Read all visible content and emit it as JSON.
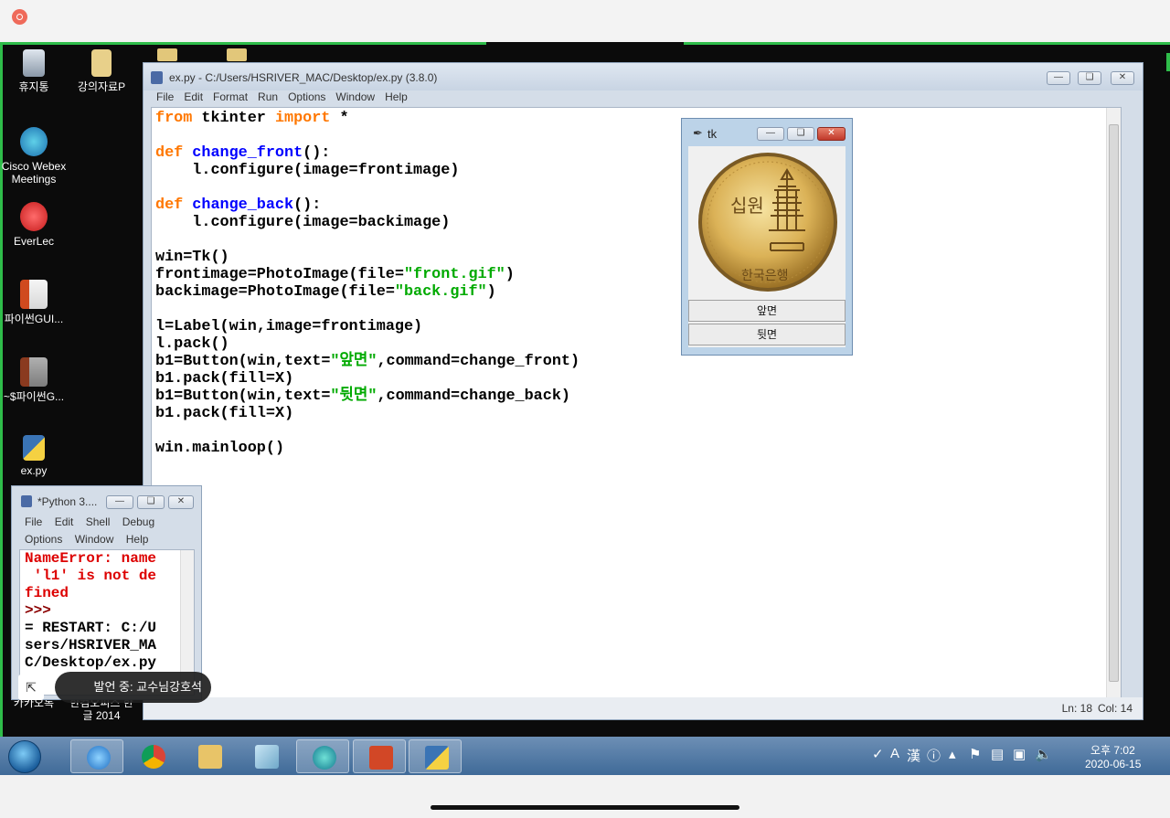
{
  "desktop": {
    "icons": [
      {
        "label": "휴지통",
        "icon": "recycle-bin-icon"
      },
      {
        "label": "강의자료P",
        "icon": "folder-icon"
      },
      {
        "label": "Cisco Webex Meetings",
        "icon": "webex-icon"
      },
      {
        "label": "EverLec",
        "icon": "everlec-icon"
      },
      {
        "label": "파이썬GUI...",
        "icon": "powerpoint-file-icon"
      },
      {
        "label": "~$파이썬G...",
        "icon": "powerpoint-file-icon"
      },
      {
        "label": "ex.py",
        "icon": "python-file-icon"
      },
      {
        "label": "카카오톡",
        "icon": "kakaotalk-icon"
      },
      {
        "label": "한컴오피스 한글 2014",
        "icon": "hancom-icon"
      }
    ]
  },
  "editor": {
    "title": "ex.py - C:/Users/HSRIVER_MAC/Desktop/ex.py (3.8.0)",
    "menu": [
      "File",
      "Edit",
      "Format",
      "Run",
      "Options",
      "Window",
      "Help"
    ],
    "code_lines": [
      "from tkinter import *",
      "",
      "def change_front():",
      "    l.configure(image=frontimage)",
      "",
      "def change_back():",
      "    l.configure(image=backimage)",
      "",
      "win=Tk()",
      "frontimage=PhotoImage(file=\"front.gif\")",
      "backimage=PhotoImage(file=\"back.gif\")",
      "",
      "l=Label(win,image=frontimage)",
      "l.pack()",
      "b1=Button(win,text=\"앞면\",command=change_front)",
      "b1.pack(fill=X)",
      "b1=Button(win,text=\"뒷면\",command=change_back)",
      "b1.pack(fill=X)",
      "",
      "win.mainloop()"
    ],
    "status": {
      "line": "Ln: 18",
      "col": "Col: 14"
    }
  },
  "tk_window": {
    "title": "tk",
    "coin_text": [
      "십원",
      "한국은행"
    ],
    "front_button": "앞면",
    "back_button": "뒷면"
  },
  "shell": {
    "title": "*Python 3....",
    "menu": [
      "File",
      "Edit",
      "Shell",
      "Debug",
      "Options",
      "Window",
      "Help"
    ],
    "lines": [
      {
        "text": "NameError: name",
        "kind": "err"
      },
      {
        "text": " 'l1' is not de",
        "kind": "err"
      },
      {
        "text": "fined",
        "kind": "err"
      },
      {
        "text": ">>>",
        "kind": "prompt"
      },
      {
        "text": "= RESTART: C:/U",
        "kind": "out"
      },
      {
        "text": "sers/HSRIVER_MA",
        "kind": "out"
      },
      {
        "text": "C/Desktop/ex.py",
        "kind": "out"
      }
    ]
  },
  "speaker_badge": "발언 중: 교수님강호석",
  "taskbar": {
    "apps": [
      "internet-explorer-icon",
      "chrome-icon",
      "file-explorer-icon",
      "notebook-icon",
      "webex-icon",
      "powerpoint-icon",
      "python-idle-icon"
    ],
    "tray_items": [
      "A",
      "漢"
    ],
    "clock_time": "오후 7:02",
    "clock_date": "2020-06-15"
  },
  "colors": {
    "keyword": "#ff7700",
    "function_name": "#0000ff",
    "string": "#00aa00",
    "error": "#dd0000",
    "taskbar": "#4f78a6",
    "recording": "#ef6a5a"
  }
}
